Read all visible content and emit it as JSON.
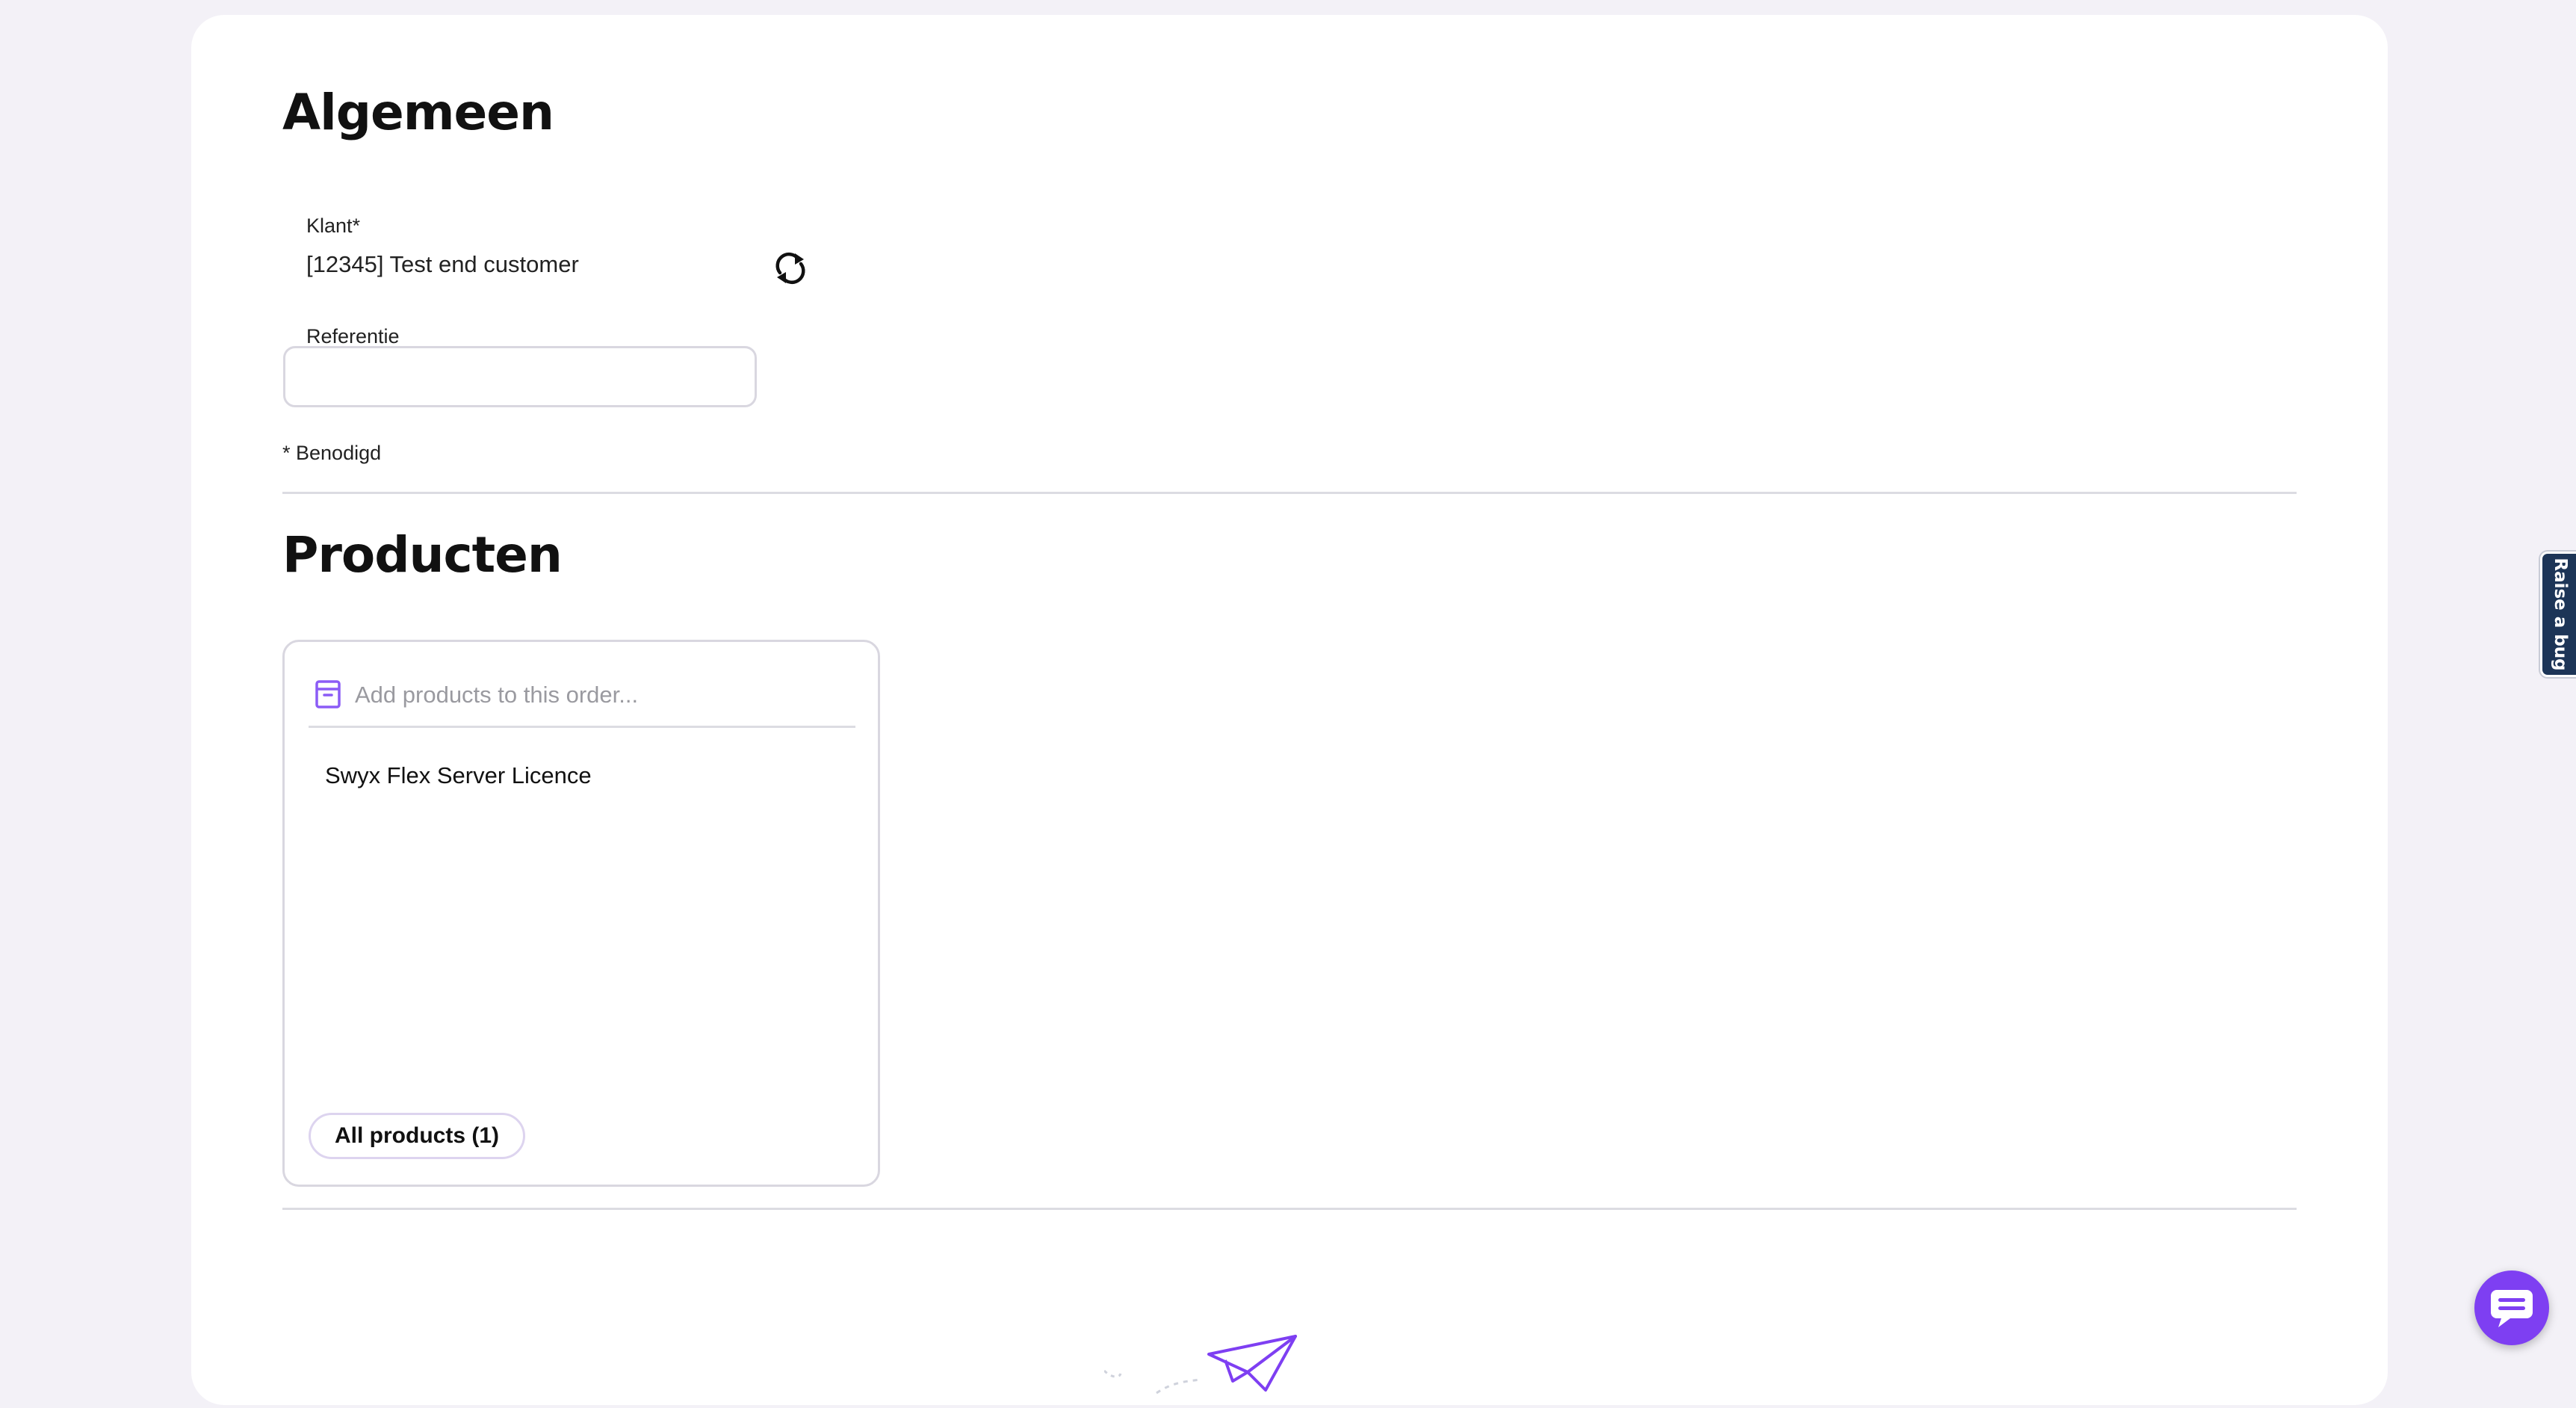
{
  "general": {
    "title": "Algemeen",
    "customer_label": "Klant*",
    "customer_value": "[12345] Test end customer",
    "reference_label": "Referentie",
    "reference_value": "",
    "required_note": "* Benodigd"
  },
  "products": {
    "title": "Producten",
    "search_placeholder": "Add products to this order...",
    "items": [
      {
        "label": "Swyx Flex Server Licence"
      }
    ],
    "all_products_label": "All products (1)"
  },
  "feedback_tab": {
    "label": "Raise a bug"
  },
  "icons": {
    "refresh": "refresh-icon",
    "product_box": "box-icon",
    "paper_plane": "paper-plane-icon",
    "chat": "chat-icon"
  },
  "colors": {
    "accent": "#7e3ff2",
    "feedback_tab": "#1d3557",
    "page_background": "#f3f1f7"
  }
}
